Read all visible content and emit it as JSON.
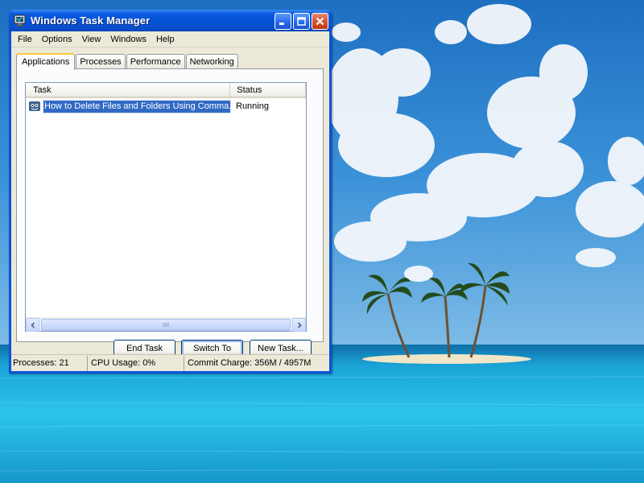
{
  "window": {
    "title": "Windows Task Manager"
  },
  "menubar": {
    "items": [
      "File",
      "Options",
      "View",
      "Windows",
      "Help"
    ]
  },
  "tabs": [
    {
      "label": "Applications",
      "active": true
    },
    {
      "label": "Processes",
      "active": false
    },
    {
      "label": "Performance",
      "active": false
    },
    {
      "label": "Networking",
      "active": false
    }
  ],
  "listview": {
    "columns": {
      "task": "Task",
      "status": "Status"
    },
    "rows": [
      {
        "task": "How to Delete Files and Folders Using Comma...",
        "status": "Running",
        "selected": true
      }
    ]
  },
  "buttons": {
    "end_task": "End Task",
    "switch_to": "Switch To",
    "new_task": "New Task..."
  },
  "statusbar": {
    "processes": "Processes: 21",
    "cpu": "CPU Usage: 0%",
    "commit": "Commit Charge: 356M / 4957M"
  },
  "colors": {
    "titlebar": "#0553d6",
    "selection": "#316ac5",
    "close_button": "#d5502a",
    "client_bg": "#ece9d8"
  },
  "icons": {
    "title": "task-manager-icon",
    "row": "application-icon",
    "minimize": "minimize-icon",
    "maximize": "maximize-icon",
    "close": "close-icon"
  }
}
